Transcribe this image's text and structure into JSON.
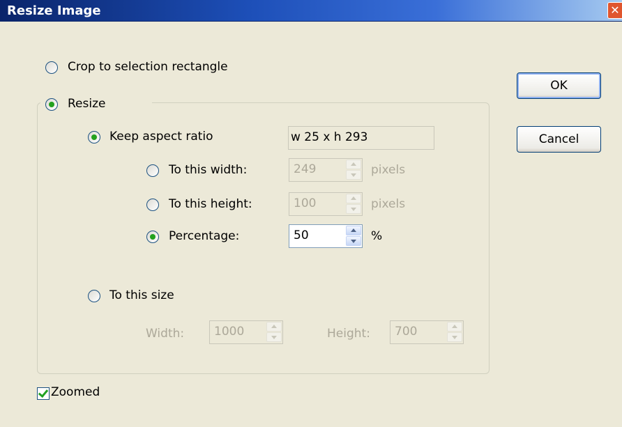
{
  "window": {
    "title": "Resize Image",
    "close_glyph": "✕"
  },
  "options": {
    "crop_label": "Crop to selection rectangle",
    "resize_label": "Resize",
    "keep_aspect_label": "Keep aspect ratio",
    "dimensions_readout": "w 25 x h 293",
    "to_width_label": "To this width:",
    "to_width_value": "249",
    "to_width_unit": "pixels",
    "to_height_label": "To this height:",
    "to_height_value": "100",
    "to_height_unit": "pixels",
    "percentage_label": "Percentage:",
    "percentage_value": "50",
    "percentage_unit": "%",
    "to_size_label": "To this size",
    "width_label": "Width:",
    "width_value": "1000",
    "height_label": "Height:",
    "height_value": "700"
  },
  "buttons": {
    "ok": "OK",
    "cancel": "Cancel"
  },
  "zoomed_label": "Zoomed",
  "state": {
    "selected_mode": "resize",
    "keep_aspect_ratio": true,
    "aspect_option": "percentage",
    "zoomed": true
  }
}
